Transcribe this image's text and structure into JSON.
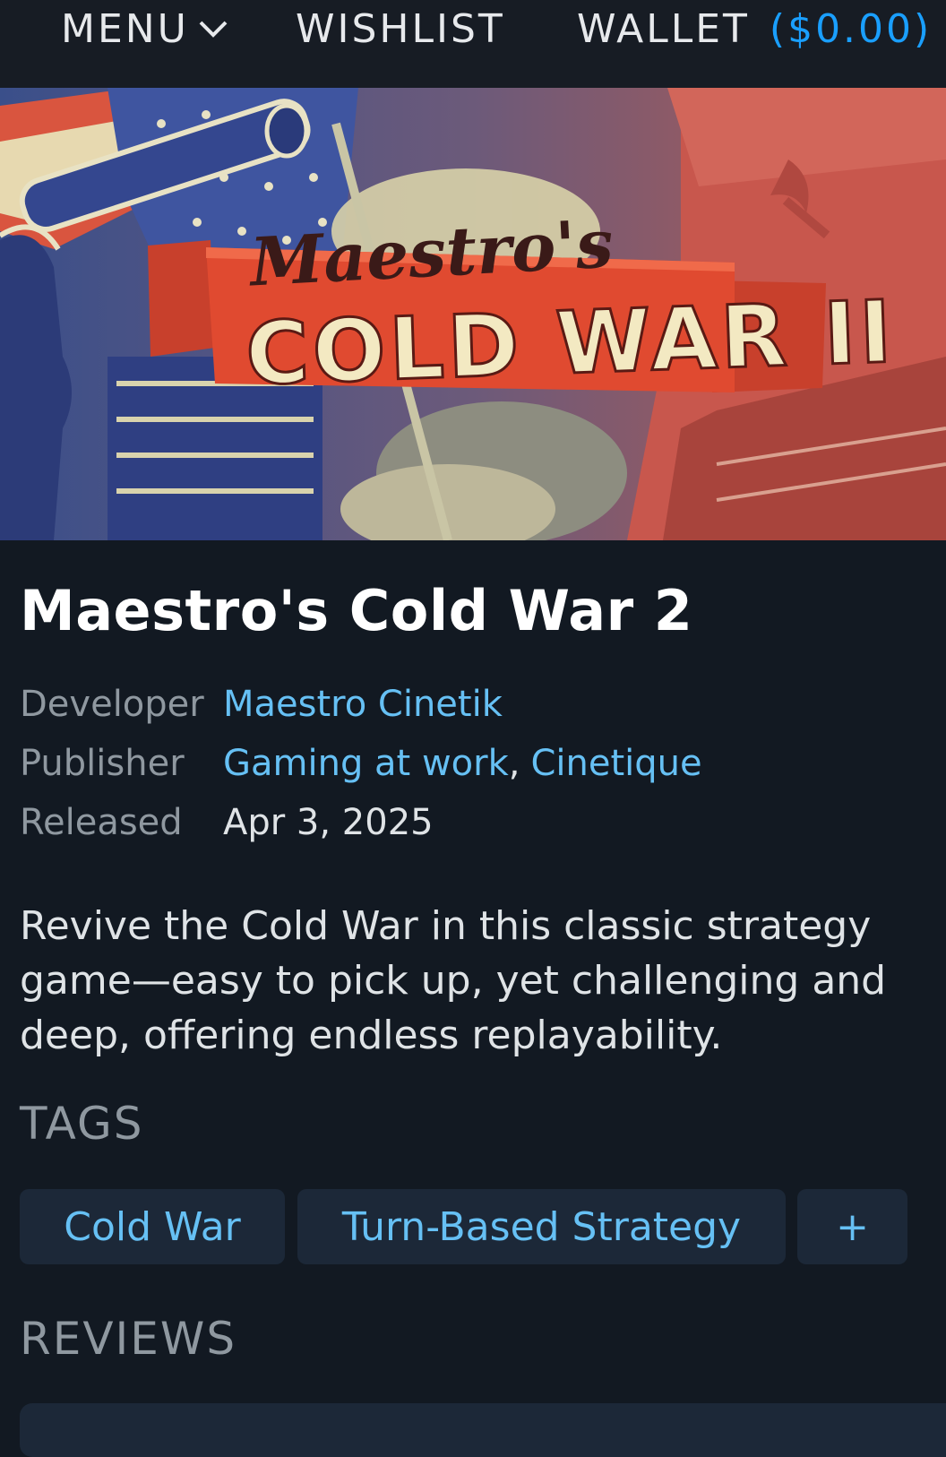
{
  "nav": {
    "menu": "MENU",
    "wishlist": "WISHLIST",
    "wallet": "WALLET",
    "wallet_balance": "($0.00)"
  },
  "hero": {
    "logo_script": "Maestro's",
    "logo_title": "COLD WAR II"
  },
  "game": {
    "title": "Maestro's Cold War 2",
    "developer_label": "Developer",
    "developer": "Maestro Cinetik",
    "publisher_label": "Publisher",
    "publisher_1": "Gaming at work",
    "publisher_sep": ",",
    "publisher_2": "Cinetique",
    "released_label": "Released",
    "released": "Apr 3, 2025",
    "description": "Revive the Cold War in this classic strategy game—easy to pick up, yet challenging and deep, offering endless replayability."
  },
  "tags": {
    "heading": "TAGS",
    "items": [
      "Cold War",
      "Turn-Based Strategy"
    ],
    "add_label": "+"
  },
  "reviews": {
    "heading": "REVIEWS"
  },
  "colors": {
    "background": "#121922",
    "link": "#66c0f4",
    "wallet": "#1a9fff",
    "tag_bg": "#1c2838"
  }
}
